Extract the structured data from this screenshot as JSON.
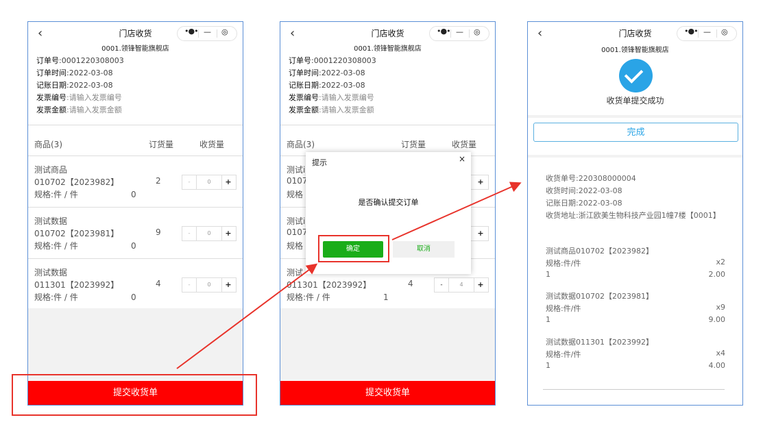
{
  "nav": {
    "title": "门店收货",
    "back_icon": "‹",
    "more_icon": "•●•",
    "minimize_icon": "—",
    "close_icon": "◎"
  },
  "store_name": "0001.领锋智能旗舰店",
  "order": {
    "order_no_label": "订单号",
    "order_no": ":0001220308003",
    "order_time_label": "订单时间",
    "order_time": ":2022-03-08",
    "post_date_label": "记账日期",
    "post_date": ":2022-03-08",
    "invoice_no_label": "发票编号",
    "invoice_no_placeholder": ":请输入发票编号",
    "invoice_amt_label": "发票金额",
    "invoice_amt_placeholder": ":请输入发票金额"
  },
  "table": {
    "col_goods": "商品(3)",
    "col_ordered": "订货量",
    "col_received": "收货量"
  },
  "items": [
    {
      "name": "测试商品",
      "code": "010702【2023982】",
      "spec": "规格:件 / 件",
      "ordered": "2",
      "zero": "0",
      "minus": "-",
      "qty_p1": "0",
      "plus": "+"
    },
    {
      "name": "测试数据",
      "code": "010702【2023981】",
      "spec": "规格:件 / 件",
      "ordered": "9",
      "zero": "0",
      "minus": "-",
      "qty_p1": "0",
      "plus": "+"
    },
    {
      "name": "测试数据",
      "code": "011301【2023992】",
      "spec": "规格:件 / 件",
      "ordered": "4",
      "zero": "0",
      "minus": "-",
      "qty_p1": "0",
      "plus": "+"
    }
  ],
  "screen2": {
    "item_prefix_1": "测试i",
    "code_prefix_1": "0107",
    "spec_prefix_1": "规格",
    "item_prefix_2": "测试i",
    "code_prefix_2": "0107",
    "spec_prefix_2": "规格",
    "item_prefix_3": "测试",
    "code_3": "011301【2023992】",
    "spec_3": "规格:件 / 件",
    "ordered_3": "4",
    "zero_3": "1",
    "qty_3": "4"
  },
  "submit_label": "提交收货单",
  "dialog": {
    "title": "提示",
    "close": "×",
    "message": "是否确认提交订单",
    "confirm": "确定",
    "cancel": "取消"
  },
  "result": {
    "success_text": "收货单提交成功",
    "done_label": "完成",
    "receipt_no": "收货单号:220308000004",
    "receipt_time": "收货时间:2022-03-08",
    "post_date": "记账日期:2022-03-08",
    "address": "收货地址:浙江欧美生物科技产业园1幢7楼【0001】",
    "lines": [
      {
        "title": "测试商品010702【2023982】",
        "spec": "规格:件/件",
        "qty": "x2",
        "count": "1",
        "amount": "2.00"
      },
      {
        "title": "测试数据010702【2023981】",
        "spec": "规格:件/件",
        "qty": "x9",
        "count": "1",
        "amount": "9.00"
      },
      {
        "title": "测试数据011301【2023992】",
        "spec": "规格:件/件",
        "qty": "x4",
        "count": "1",
        "amount": "4.00"
      }
    ]
  },
  "colors": {
    "submit_red": "#ff0000",
    "confirm_green": "#1aad19",
    "success_blue": "#2aa4e6",
    "annotation_red": "#e8332b"
  }
}
